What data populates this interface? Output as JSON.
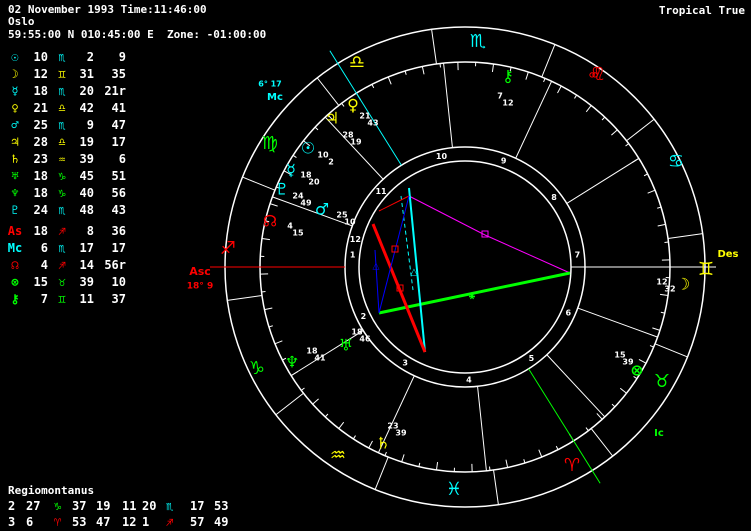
{
  "header": {
    "line1": "02 November 1993 Time:11:46:00",
    "line2": "Oslo",
    "line3": "59:55:00 N 010:45:00 E  Zone: -01:00:00",
    "mode": "Tropical True"
  },
  "planets": [
    {
      "glyph": "☉",
      "deg": "10",
      "sign": "♏",
      "min": "2",
      "sec": "9",
      "gcolor": "#00ffff",
      "scolor": "#00ffff"
    },
    {
      "glyph": "☽",
      "deg": "12",
      "sign": "♊",
      "min": "31",
      "sec": "35",
      "gcolor": "#ffff00",
      "scolor": "#ffff00"
    },
    {
      "glyph": "☿",
      "deg": "18",
      "sign": "♏",
      "min": "20",
      "sec": "21r",
      "gcolor": "#00ffff",
      "scolor": "#00ffff"
    },
    {
      "glyph": "♀",
      "deg": "21",
      "sign": "♎",
      "min": "42",
      "sec": "41",
      "gcolor": "#ffff00",
      "scolor": "#ffff00"
    },
    {
      "glyph": "♂",
      "deg": "25",
      "sign": "♏",
      "min": "9",
      "sec": "47",
      "gcolor": "#00ffff",
      "scolor": "#00ffff"
    },
    {
      "glyph": "♃",
      "deg": "28",
      "sign": "♎",
      "min": "19",
      "sec": "17",
      "gcolor": "#ffff00",
      "scolor": "#ffff00"
    },
    {
      "glyph": "♄",
      "deg": "23",
      "sign": "♒",
      "min": "39",
      "sec": "6",
      "gcolor": "#ffff00",
      "scolor": "#ffff00"
    },
    {
      "glyph": "♅",
      "deg": "18",
      "sign": "♑",
      "min": "45",
      "sec": "51",
      "gcolor": "#00ff00",
      "scolor": "#00ff00"
    },
    {
      "glyph": "♆",
      "deg": "18",
      "sign": "♑",
      "min": "40",
      "sec": "56",
      "gcolor": "#00ff00",
      "scolor": "#00ff00"
    },
    {
      "glyph": "♇",
      "deg": "24",
      "sign": "♏",
      "min": "48",
      "sec": "43",
      "gcolor": "#00ffff",
      "scolor": "#00ffff"
    },
    {
      "glyph": "As",
      "deg": "18",
      "sign": "♐",
      "min": "8",
      "sec": "36",
      "gcolor": "#ff0000",
      "scolor": "#ff0000"
    },
    {
      "glyph": "Mc",
      "deg": "6",
      "sign": "♏",
      "min": "17",
      "sec": "17",
      "gcolor": "#00ffff",
      "scolor": "#00ffff"
    },
    {
      "glyph": "☊",
      "deg": "4",
      "sign": "♐",
      "min": "14",
      "sec": "56r",
      "gcolor": "#ff0000",
      "scolor": "#ff0000"
    },
    {
      "glyph": "⊗",
      "deg": "15",
      "sign": "♉",
      "min": "39",
      "sec": "10",
      "gcolor": "#00ff00",
      "scolor": "#00ff00"
    },
    {
      "glyph": "⚷",
      "deg": "7",
      "sign": "♊",
      "min": "11",
      "sec": "37",
      "gcolor": "#00ff00",
      "scolor": "#00ff00"
    }
  ],
  "houses": {
    "title": "Regiomontanus",
    "rows": [
      [
        "2",
        "27",
        "♑",
        "37",
        "19",
        "11",
        "20",
        "♏",
        "17",
        "53"
      ],
      [
        "3",
        "6",
        "♈",
        "53",
        "47",
        "12",
        "1",
        "♐",
        "57",
        "49"
      ]
    ]
  },
  "chart": {
    "axis_labels": {
      "asc": "Asc",
      "asc_pos": "18° 9",
      "des": "Des",
      "mc": "Mc",
      "mc_pos": "6° 17",
      "ic": "Ic"
    },
    "zodiac": [
      {
        "g": "♏",
        "c": "#00ffff"
      },
      {
        "g": "♌",
        "c": "#ff0000"
      },
      {
        "g": "♐",
        "c": "#ff0000"
      },
      {
        "g": "♑",
        "c": "#00ff00"
      },
      {
        "g": "♒",
        "c": "#ffff00"
      },
      {
        "g": "♓",
        "c": "#00ffff"
      },
      {
        "g": "♈",
        "c": "#ff0000"
      },
      {
        "g": "♉",
        "c": "#00ff00"
      },
      {
        "g": "♊",
        "c": "#ffff00"
      },
      {
        "g": "♋",
        "c": "#00ffff"
      },
      {
        "g": "♌",
        "c": "#ff0000"
      },
      {
        "g": "♍",
        "c": "#00ff00"
      },
      {
        "g": "♎",
        "c": "#ffff00"
      }
    ],
    "house_numbers": [
      "1",
      "2",
      "3",
      "4",
      "5",
      "6",
      "7",
      "8",
      "9",
      "10",
      "11",
      "12"
    ],
    "placements": [
      {
        "g": "♃",
        "d": "28",
        "m": "19",
        "c": "#ffff00"
      },
      {
        "g": "♀",
        "d": "21",
        "m": "43",
        "c": "#ffff00"
      },
      {
        "g": "☉",
        "d": "10",
        "m": "2",
        "c": "#00ffff"
      },
      {
        "g": "☿",
        "d": "18",
        "m": "20",
        "c": "#00ffff"
      },
      {
        "g": "♇",
        "d": "24",
        "m": "49",
        "c": "#00ffff"
      },
      {
        "g": "♂",
        "d": "25",
        "m": "10",
        "c": "#00ffff"
      },
      {
        "g": "☊",
        "d": "4",
        "m": "15",
        "c": "#ff0000"
      },
      {
        "g": "♆",
        "d": "18",
        "m": "41",
        "c": "#00ff00"
      },
      {
        "g": "♅",
        "d": "18",
        "m": "46",
        "c": "#00ff00"
      },
      {
        "g": "♄",
        "d": "23",
        "m": "39",
        "c": "#ffff00"
      },
      {
        "g": "⊗",
        "d": "15",
        "m": "39",
        "c": "#00ff00"
      },
      {
        "g": "☽",
        "d": "12",
        "m": "32",
        "c": "#ffff00"
      },
      {
        "g": "⚷",
        "d": "7",
        "m": "12",
        "c": "#00ff00"
      }
    ]
  }
}
